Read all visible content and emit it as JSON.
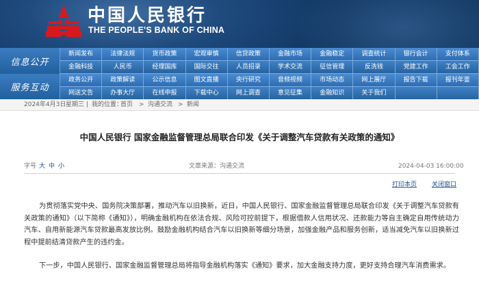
{
  "header": {
    "title_cn": "中国人民银行",
    "title_en": "THE PEOPLE'S BANK OF CHINA",
    "logo_icon": "pboc-emblem-icon",
    "brand_red": "#d7191d"
  },
  "nav": {
    "section1_label": "信息公开",
    "section2_label": "服务互动",
    "row1": [
      "新闻发布",
      "法律法规",
      "货币政策",
      "宏观审慎",
      "信贷政策",
      "金融市场",
      "金融稳定",
      "调查统计",
      "银行会计",
      "支付体系"
    ],
    "row2": [
      "金融科技",
      "人民币",
      "经理国库",
      "国际交往",
      "人员招录",
      "学术交流",
      "征信管理",
      "反洗钱",
      "党建工作",
      "工会工作"
    ],
    "row3": [
      "政务公开",
      "政策解读",
      "公示信息",
      "图文直播",
      "央行研究",
      "音频视频",
      "市场动态",
      "网上展厅",
      "报告下载",
      "报刊年鉴"
    ],
    "row4": [
      "网送文告",
      "办事大厅",
      "在线申报",
      "下载中心",
      "网上调查",
      "意见征集",
      "金融知识",
      "关于我们",
      "",
      ""
    ]
  },
  "breadcrumb": {
    "date": "2024年4月3日",
    "weekday": "星期三",
    "sep": "|",
    "location_label": "我的位置：",
    "home": "首页",
    "arrow1": ">",
    "level1": "沟通交流",
    "arrow2": ">",
    "level2": "新闻"
  },
  "article": {
    "title": "中国人民银行 国家金融监督管理总局联合印发《关于调整汽车贷款有关政策的通知》",
    "font_size_label": "字号",
    "font_large": "大",
    "font_medium": "中",
    "font_small": "小",
    "source_label": "文章来源：",
    "source": "沟通交流",
    "datetime": "2024-04-03 16:00:00",
    "print_label": "打印本页",
    "close_label": "关闭窗口",
    "paragraph1": "为贯彻落实党中央、国务院决策部署，推动汽车以旧换新，近日，中国人民银行、国家金融监督管理总局联合印发《关于调整汽车贷款有关政策的通知》（以下简称《通知》），明确金融机构在依法合规、风险可控前提下，根据借款人信用状况、还款能力等自主确定自用传统动力汽车、自用新能源汽车贷款最高发放比例。鼓励金融机构结合汽车以旧换新等细分场景，加强金融产品和服务创新，适当减免汽车以旧换新过程中提前结清贷款产生的违约金。",
    "paragraph2": "下一步，中国人民银行、国家金融监督管理总局将指导金融机构落实《通知》要求，加大金融支持力度，更好支持合理汽车消费需求。"
  }
}
